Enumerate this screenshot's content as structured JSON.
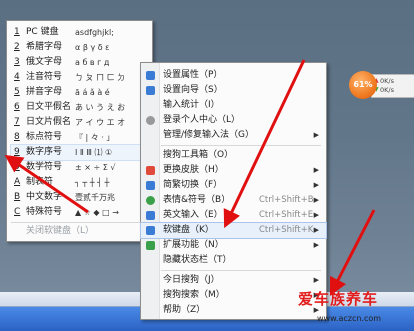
{
  "keyboard_menu": {
    "items": [
      {
        "num": "1",
        "label": "PC 键盘",
        "sample": "asdfghjkl;"
      },
      {
        "num": "2",
        "label": "希腊字母",
        "sample": "α β γ δ ε"
      },
      {
        "num": "3",
        "label": "俄文字母",
        "sample": "а б в г д"
      },
      {
        "num": "4",
        "label": "注音符号",
        "sample": "ㄅ ㄆ ㄇ ㄈ ㄉ"
      },
      {
        "num": "5",
        "label": "拼音字母",
        "sample": "ā á ǎ à é"
      },
      {
        "num": "6",
        "label": "日文平假名",
        "sample": "あ い う え お"
      },
      {
        "num": "7",
        "label": "日文片假名",
        "sample": "ア イ ウ エ オ"
      },
      {
        "num": "8",
        "label": "标点符号",
        "sample": "『 | 々 · 」"
      },
      {
        "num": "9",
        "label": "数字序号",
        "sample": "Ⅰ Ⅱ Ⅲ ⑴ ①"
      },
      {
        "num": "0",
        "label": "数学符号",
        "sample": "± × ÷ Σ √"
      },
      {
        "num": "A",
        "label": "制表符",
        "sample": "┐ ┬ ┼ ┤ ┼"
      },
      {
        "num": "B",
        "label": "中文数字",
        "sample": "壹贰千万兆"
      },
      {
        "num": "C",
        "label": "特殊符号",
        "sample": "▲ ☆ ◆ □ →"
      }
    ],
    "close_label": "关闭软键盘（L）"
  },
  "main_menu": {
    "items": [
      {
        "label": "设置属性（P）",
        "shortcut": "",
        "submenu": false,
        "icon": "settings-icon",
        "color": "#3a7bd5"
      },
      {
        "label": "设置向导（S）",
        "shortcut": "",
        "submenu": false,
        "icon": "wizard-icon",
        "color": "#3a7bd5"
      },
      {
        "label": "输入统计（I）",
        "shortcut": "",
        "submenu": false,
        "icon": "",
        "color": ""
      },
      {
        "label": "登录个人中心（L）",
        "shortcut": "",
        "submenu": false,
        "icon": "user-icon",
        "color": "#999999"
      },
      {
        "label": "管理/修复输入法（G）",
        "shortcut": "",
        "submenu": true,
        "icon": "",
        "color": ""
      },
      {
        "label": "搜狗工具箱（O）",
        "shortcut": "",
        "submenu": false,
        "icon": "",
        "color": ""
      },
      {
        "label": "更换皮肤（H）",
        "shortcut": "",
        "submenu": true,
        "icon": "skin-icon",
        "color": "#e04a3a"
      },
      {
        "label": "简繁切换（F）",
        "shortcut": "",
        "submenu": true,
        "icon": "convert-icon",
        "color": "#3a7bd5"
      },
      {
        "label": "表情&符号（B）",
        "shortcut": "Ctrl+Shift+B",
        "submenu": true,
        "icon": "emoji-icon",
        "color": "#3aa04a"
      },
      {
        "label": "英文输入（E）",
        "shortcut": "Ctrl+Shift+E",
        "submenu": true,
        "icon": "english-icon",
        "color": "#3a7bd5"
      },
      {
        "label": "软键盘（K）",
        "shortcut": "Ctrl+Shift+K",
        "submenu": true,
        "icon": "keyboard-icon",
        "color": "#3a7bd5"
      },
      {
        "label": "扩展功能（N）",
        "shortcut": "",
        "submenu": true,
        "icon": "extension-icon",
        "color": "#3aa04a"
      },
      {
        "label": "隐藏状态栏（T）",
        "shortcut": "",
        "submenu": false,
        "icon": "",
        "color": ""
      },
      {
        "label": "今日搜狗（J）",
        "shortcut": "",
        "submenu": true,
        "icon": "",
        "color": ""
      },
      {
        "label": "搜狗搜索（M）",
        "shortcut": "",
        "submenu": true,
        "icon": "",
        "color": ""
      },
      {
        "label": "帮助（Z）",
        "shortcut": "",
        "submenu": true,
        "icon": "",
        "color": ""
      }
    ]
  },
  "widget": {
    "percent": "61%",
    "line1": "0K/s",
    "line2": "0K/s"
  },
  "watermark": {
    "title": "爱车族养车",
    "url": "www.aczcn.com"
  },
  "colors": {
    "arrow": "#e01010",
    "watermark": "#e21c1c"
  }
}
